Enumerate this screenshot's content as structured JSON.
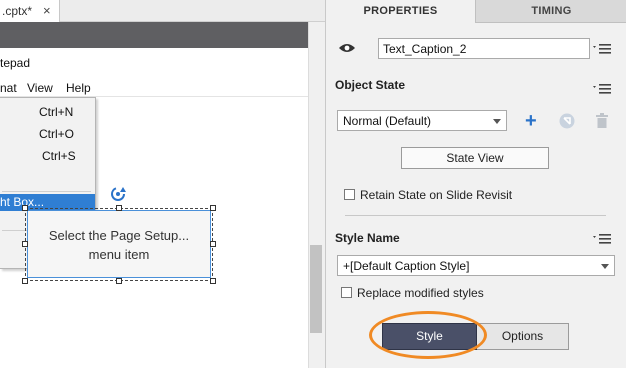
{
  "editor": {
    "doc_tab": ".cptx*",
    "doc_tab_close": "×",
    "notepad_title": "tepad",
    "menubar": [
      "nat",
      "View",
      "Help"
    ],
    "dropdown": {
      "shortcuts": [
        "Ctrl+N",
        "Ctrl+O",
        "Ctrl+S"
      ],
      "highlighted_item": "ht Box..."
    },
    "caption": {
      "line1": "Select the Page Setup...",
      "line2": "menu item"
    }
  },
  "panel": {
    "tabs": {
      "properties": "PROPERTIES",
      "timing": "TIMING"
    },
    "item_name": "Text_Caption_2",
    "object_state": {
      "title": "Object State",
      "selected": "Normal (Default)",
      "state_view_label": "State View",
      "retain_label": "Retain State on Slide Revisit"
    },
    "style_name": {
      "title": "Style Name",
      "selected": "+[Default Caption Style]",
      "replace_label": "Replace modified styles"
    },
    "segments": {
      "style": "Style",
      "options": "Options"
    }
  },
  "colors": {
    "accent_blue": "#2b73c9",
    "highlight_orange": "#f08a24",
    "style_button": "#4a5068"
  }
}
